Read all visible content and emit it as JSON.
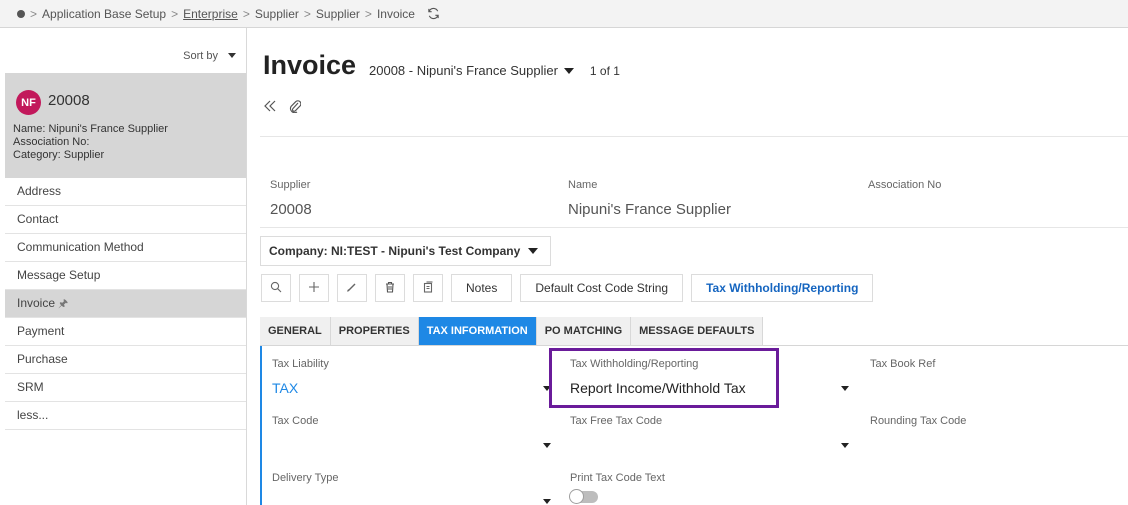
{
  "breadcrumb": {
    "items": [
      "Application Base Setup",
      "Enterprise",
      "Supplier",
      "Supplier",
      "Invoice"
    ],
    "separator": ">"
  },
  "sidebar": {
    "sort_label": "Sort by",
    "card": {
      "initials": "NF",
      "id": "20008",
      "name_line": "Name:  Nipuni's France Supplier",
      "association_line": "Association No:",
      "category_line": "Category:  Supplier"
    },
    "nav_items": [
      {
        "label": "Address"
      },
      {
        "label": "Contact"
      },
      {
        "label": "Communication Method"
      },
      {
        "label": "Message Setup"
      },
      {
        "label": "Invoice",
        "active": true
      },
      {
        "label": "Payment"
      },
      {
        "label": "Purchase"
      },
      {
        "label": "SRM"
      },
      {
        "label": "less..."
      }
    ]
  },
  "header": {
    "title": "Invoice",
    "record": "20008 - Nipuni's France Supplier",
    "count": "1 of 1"
  },
  "summary": {
    "supplier_label": "Supplier",
    "supplier_value": "20008",
    "name_label": "Name",
    "name_value": "Nipuni's France Supplier",
    "association_label": "Association No"
  },
  "company": {
    "label": "Company: NI:TEST - Nipuni's Test Company"
  },
  "command_bar": {
    "notes": "Notes",
    "default_cost_code": "Default Cost Code String",
    "tax_withholding": "Tax Withholding/Reporting"
  },
  "tabs": [
    {
      "label": "GENERAL"
    },
    {
      "label": "PROPERTIES"
    },
    {
      "label": "TAX INFORMATION",
      "active": true
    },
    {
      "label": "PO MATCHING"
    },
    {
      "label": "MESSAGE DEFAULTS"
    }
  ],
  "fields": {
    "tax_liability": {
      "label": "Tax Liability",
      "value": "TAX"
    },
    "tax_withholding": {
      "label": "Tax Withholding/Reporting",
      "value": "Report Income/Withhold Tax"
    },
    "tax_book_ref": {
      "label": "Tax Book Ref"
    },
    "tax_code": {
      "label": "Tax Code"
    },
    "tax_free_tax_code": {
      "label": "Tax Free Tax Code"
    },
    "rounding_tax_code": {
      "label": "Rounding Tax Code"
    },
    "delivery_type": {
      "label": "Delivery Type"
    },
    "print_tax_code_text": {
      "label": "Print Tax Code Text",
      "value": false
    }
  },
  "colors": {
    "accent": "#1e88e5",
    "link": "#1565c0",
    "highlight": "#6a1b9a",
    "avatar": "#c2185b"
  }
}
